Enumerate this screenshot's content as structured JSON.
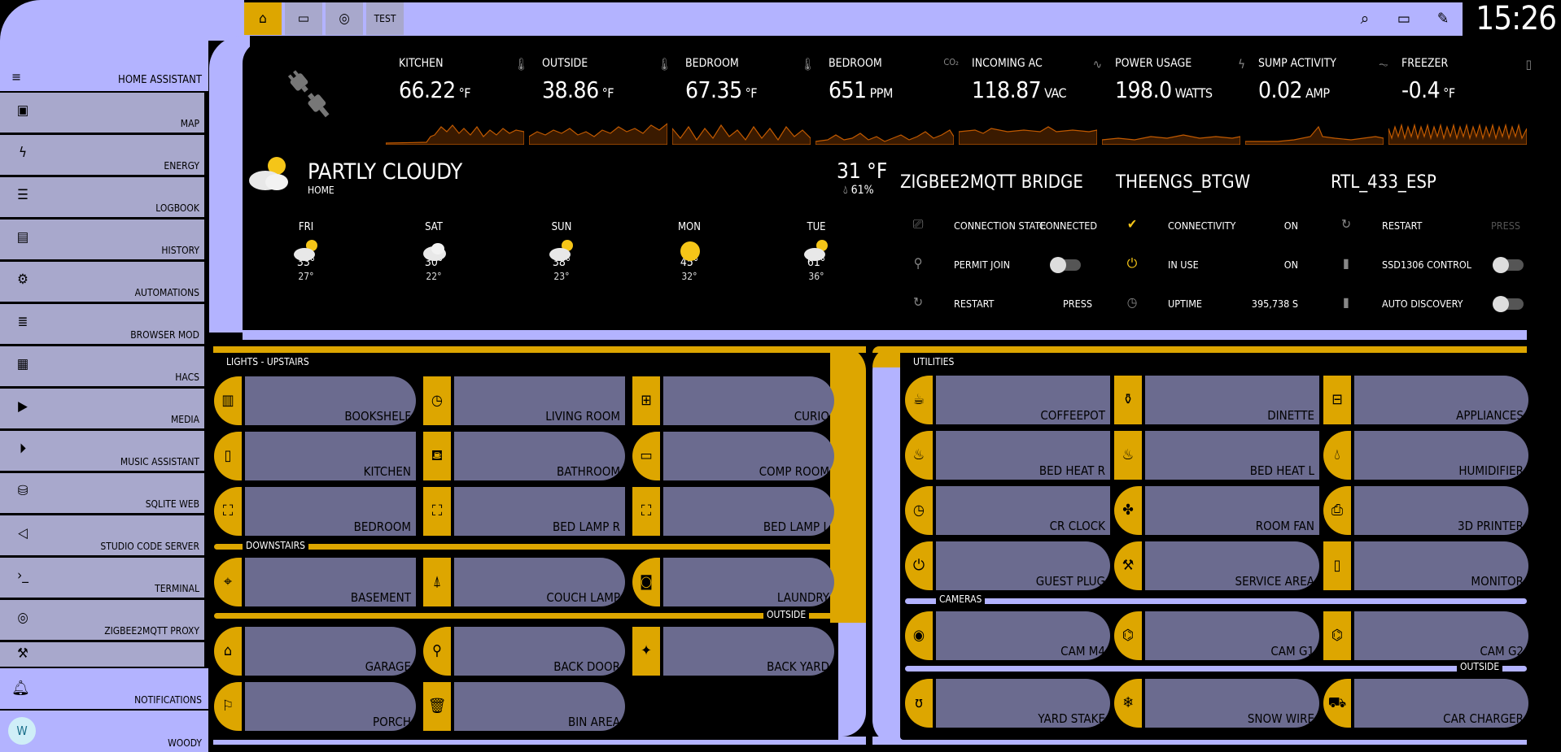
{
  "app": {
    "title": "HOME ASSISTANT"
  },
  "sidebar": {
    "items": [
      {
        "label": "MAP",
        "icon": "account-box-icon"
      },
      {
        "label": "ENERGY",
        "icon": "lightning-icon"
      },
      {
        "label": "LOGBOOK",
        "icon": "list-icon"
      },
      {
        "label": "HISTORY",
        "icon": "chart-box-icon"
      },
      {
        "label": "AUTOMATIONS",
        "icon": "cogs-icon"
      },
      {
        "label": "BROWSER MOD",
        "icon": "server-icon"
      },
      {
        "label": "HACS",
        "icon": "hacs-icon"
      },
      {
        "label": "MEDIA",
        "icon": "play-box-icon"
      },
      {
        "label": "MUSIC ASSISTANT",
        "icon": "play-circle-icon"
      },
      {
        "label": "SQLITE WEB",
        "icon": "database-icon"
      },
      {
        "label": "STUDIO CODE SERVER",
        "icon": "vscode-icon"
      },
      {
        "label": "TERMINAL",
        "icon": "console-icon"
      },
      {
        "label": "ZIGBEE2MQTT PROXY",
        "icon": "zigbee-icon"
      }
    ],
    "notifications": "NOTIFICATIONS",
    "user": {
      "name": "WOODY",
      "initial": "W"
    }
  },
  "topbar": {
    "tabs": [
      {
        "name": "home",
        "icon": "home-icon"
      },
      {
        "name": "cast",
        "icon": "cast-icon"
      },
      {
        "name": "radar",
        "icon": "radar-icon"
      },
      {
        "name": "test",
        "label": "TEST"
      }
    ],
    "time": "15:26"
  },
  "sensors": [
    {
      "name": "KITCHEN",
      "value": "66.22",
      "unit": "°F",
      "icon": "thermometer-icon"
    },
    {
      "name": "OUTSIDE",
      "value": "38.86",
      "unit": "°F",
      "icon": "thermometer-icon"
    },
    {
      "name": "BEDROOM",
      "value": "67.35",
      "unit": "°F",
      "icon": "thermometer-icon"
    },
    {
      "name": "BEDROOM",
      "value": "651",
      "unit": "PPM",
      "icon": "co2-icon"
    },
    {
      "name": "INCOMING AC",
      "value": "118.87",
      "unit": "VAC",
      "icon": "sine-wave-icon"
    },
    {
      "name": "POWER USAGE",
      "value": "198.0",
      "unit": "WATTS",
      "icon": "flash-icon"
    },
    {
      "name": "SUMP ACTIVITY",
      "value": "0.02",
      "unit": "AMP",
      "icon": "current-ac-icon"
    },
    {
      "name": "FREEZER",
      "value": "-0.4",
      "unit": "°F",
      "icon": "fridge-icon"
    }
  ],
  "weather": {
    "condition": "PARTLY CLOUDY",
    "location": "HOME",
    "temp": "31 °F",
    "humidity": "61%",
    "forecast": [
      {
        "day": "FRI",
        "hi": "33°",
        "lo": "27°",
        "icon": "partly-cloudy"
      },
      {
        "day": "SAT",
        "hi": "30°",
        "lo": "22°",
        "icon": "cloudy"
      },
      {
        "day": "SUN",
        "hi": "38°",
        "lo": "23°",
        "icon": "partly-cloudy"
      },
      {
        "day": "MON",
        "hi": "45°",
        "lo": "32°",
        "icon": "sunny"
      },
      {
        "day": "TUE",
        "hi": "61°",
        "lo": "36°",
        "icon": "partly-cloudy"
      }
    ]
  },
  "bridges": [
    {
      "title": "ZIGBEE2MQTT BRIDGE",
      "rows": [
        {
          "icon": "lan-icon",
          "label": "CONNECTION STATE",
          "value": "CONNECTED"
        },
        {
          "icon": "wifi-lock-icon",
          "label": "PERMIT JOIN",
          "toggle": true
        },
        {
          "icon": "restart-icon",
          "label": "RESTART",
          "value": "PRESS"
        }
      ]
    },
    {
      "title": "THEENGS_BTGW",
      "rows": [
        {
          "icon": "check-circle-icon",
          "label": "CONNECTIVITY",
          "value": "ON"
        },
        {
          "icon": "power-plug-icon",
          "label": "IN USE",
          "value": "ON"
        },
        {
          "icon": "clock-icon",
          "label": "UPTIME",
          "value": "395,738 S"
        }
      ]
    },
    {
      "title": "RTL_433_ESP",
      "rows": [
        {
          "icon": "restart-icon",
          "label": "RESTART",
          "value": "PRESS"
        },
        {
          "icon": "device-icon",
          "label": "SSD1306 CONTROL",
          "toggle": true
        },
        {
          "icon": "device-icon",
          "label": "AUTO DISCOVERY",
          "toggle": true
        }
      ]
    }
  ],
  "lights": {
    "title": "LIGHTS - UPSTAIRS",
    "downstairs": "DOWNSTAIRS",
    "outside": "OUTSIDE",
    "upstairs": [
      {
        "label": "BOOKSHELF",
        "icon": "bookshelf-icon"
      },
      {
        "label": "LIVING ROOM",
        "icon": "clock-icon"
      },
      {
        "label": "CURIO",
        "icon": "cabinet-icon"
      },
      {
        "label": "KITCHEN",
        "icon": "fridge-icon"
      },
      {
        "label": "BATHROOM",
        "icon": "bathtub-icon"
      },
      {
        "label": "COMP ROOM",
        "icon": "desk-icon"
      },
      {
        "label": "BEDROOM",
        "icon": "bed-icon"
      },
      {
        "label": "BED LAMP R",
        "icon": "bed-icon"
      },
      {
        "label": "BED LAMP L",
        "icon": "bed-icon"
      }
    ],
    "downstairs_items": [
      {
        "label": "BASEMENT",
        "icon": "gamepad-icon"
      },
      {
        "label": "COUCH LAMP",
        "icon": "lamp-icon"
      },
      {
        "label": "LAUNDRY",
        "icon": "washer-icon"
      }
    ],
    "outside_items": [
      {
        "label": "GARAGE",
        "icon": "garage-icon"
      },
      {
        "label": "BACK DOOR",
        "icon": "outdoor-lamp-icon"
      },
      {
        "label": "BACK YARD",
        "icon": "spotlight-icon"
      },
      {
        "label": "PORCH",
        "icon": "porch-light-icon"
      },
      {
        "label": "BIN AREA",
        "icon": "trash-icon"
      }
    ]
  },
  "utilities": {
    "title": "UTILITIES",
    "cameras": "CAMERAS",
    "outside": "OUTSIDE",
    "items": [
      {
        "label": "COFFEEPOT",
        "icon": "coffee-icon"
      },
      {
        "label": "DINETTE",
        "icon": "blender-icon"
      },
      {
        "label": "APPLIANCES",
        "icon": "toaster-icon"
      },
      {
        "label": "BED HEAT R",
        "icon": "heater-icon"
      },
      {
        "label": "BED HEAT L",
        "icon": "heater-icon"
      },
      {
        "label": "HUMIDIFIER",
        "icon": "humidifier-icon"
      },
      {
        "label": "CR CLOCK",
        "icon": "clock-icon"
      },
      {
        "label": "ROOM FAN",
        "icon": "fan-icon"
      },
      {
        "label": "3D PRINTER",
        "icon": "printer-3d-icon"
      },
      {
        "label": "GUEST PLUG",
        "icon": "plug-icon"
      },
      {
        "label": "SERVICE AREA",
        "icon": "service-icon"
      },
      {
        "label": "MONITOR",
        "icon": "tablet-icon"
      }
    ],
    "camera_items": [
      {
        "label": "CAM M4",
        "icon": "camera-icon"
      },
      {
        "label": "CAM G1",
        "icon": "cctv-icon"
      },
      {
        "label": "CAM G2",
        "icon": "cctv-icon"
      }
    ],
    "outside_items": [
      {
        "label": "YARD STAKE",
        "icon": "bear-icon"
      },
      {
        "label": "SNOW WIRE",
        "icon": "snowflake-icon"
      },
      {
        "label": "CAR CHARGER",
        "icon": "ev-icon"
      }
    ]
  },
  "colors": {
    "accent": "#dda600",
    "frame": "#b3b3ff",
    "tile": "#6b6b8f",
    "sidebar_item": "#a8a8cc",
    "spark": "#c25a00"
  }
}
